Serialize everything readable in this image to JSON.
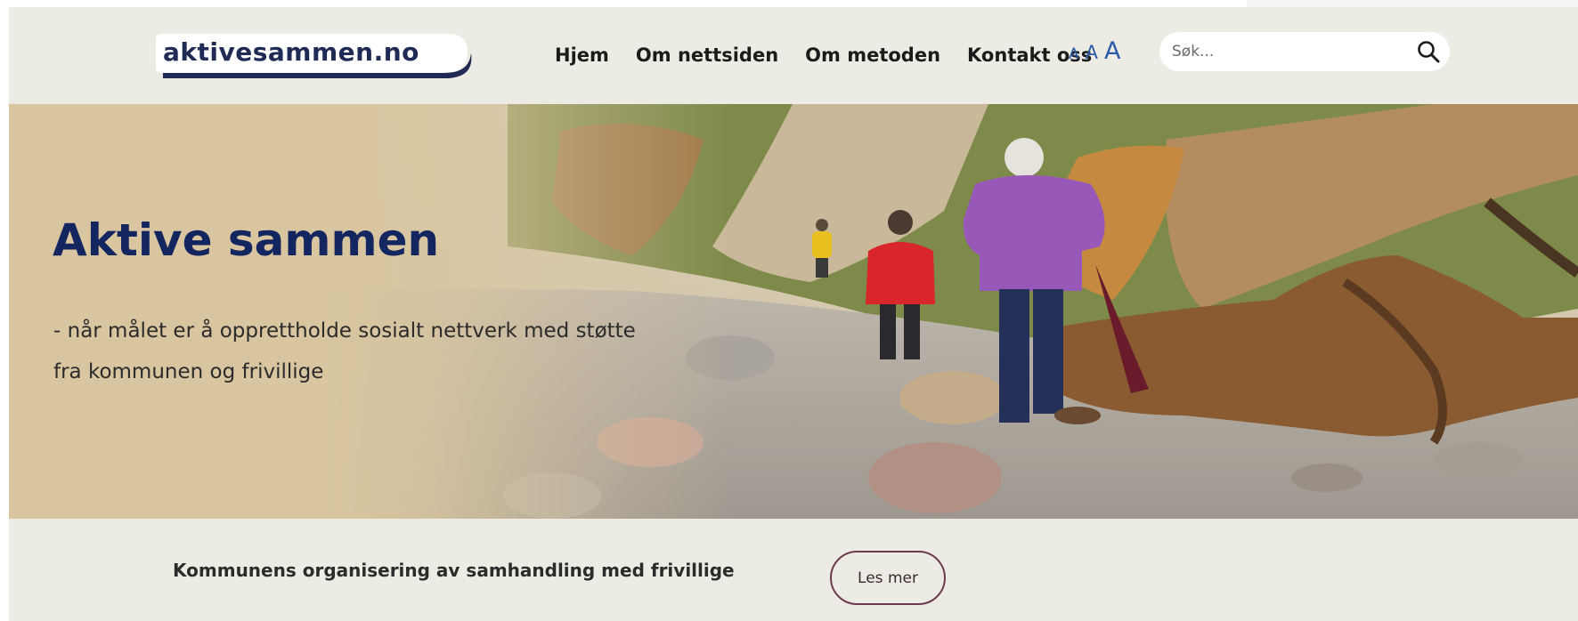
{
  "header": {
    "logo_text": "aktivesammen.no",
    "nav": [
      {
        "label": "Hjem"
      },
      {
        "label": "Om nettsiden"
      },
      {
        "label": "Om metoden"
      },
      {
        "label": "Kontakt oss"
      }
    ],
    "font_size_controls": [
      "A",
      "A",
      "A"
    ],
    "search": {
      "placeholder": "Søk...",
      "icon": "search-icon"
    }
  },
  "hero": {
    "title": "Aktive sammen",
    "subtitle": "- når målet er å opprettholde sosialt nettverk med støtte fra kommunen og frivillige"
  },
  "info": {
    "text": "Kommunens organisering av samhandling med frivillige",
    "button_label": "Les mer"
  },
  "colors": {
    "background": "#edece4",
    "title_navy": "#142660",
    "accent_blue": "#2a5aa8",
    "button_border": "#6b3a4f",
    "hero_tint": "#d9c6a0"
  }
}
